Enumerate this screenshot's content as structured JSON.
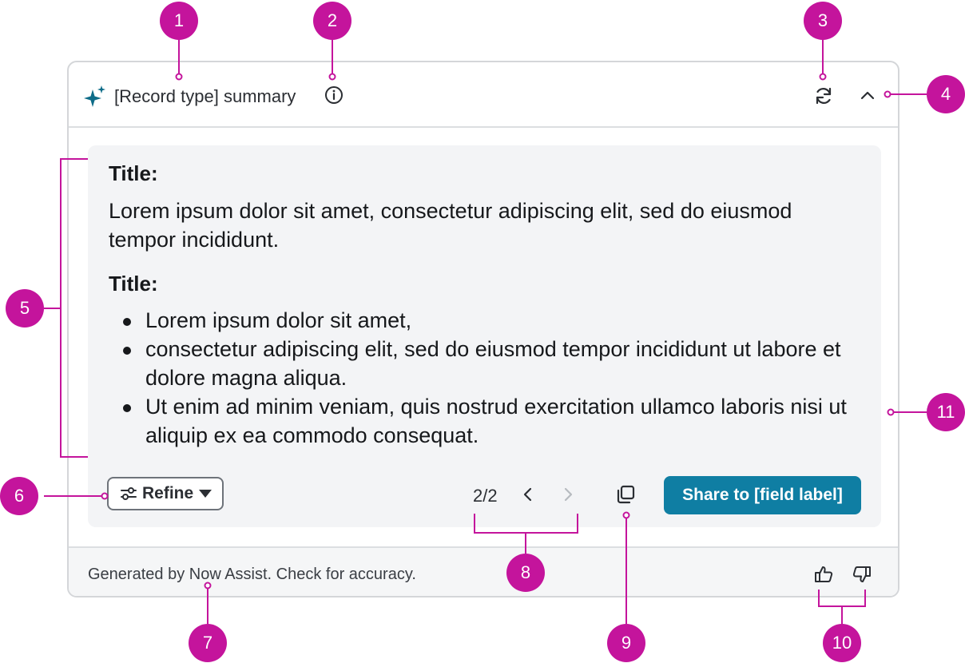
{
  "card": {
    "title": "[Record type] summary",
    "icons": {
      "sparkle": "sparkle-icon",
      "info": "info-icon",
      "refresh": "refresh-icon",
      "collapse": "chevron-up-icon"
    }
  },
  "content": {
    "section1": {
      "title": "Title:",
      "body": "Lorem ipsum dolor sit amet, consectetur adipiscing elit, sed do eiusmod tempor incididunt."
    },
    "section2": {
      "title": "Title:",
      "bullets": [
        "Lorem ipsum dolor sit amet,",
        "consectetur adipiscing elit, sed do eiusmod tempor incididunt ut labore et dolore magna aliqua.",
        "Ut enim ad minim veniam, quis nostrud exercitation ullamco laboris nisi ut aliquip ex ea commodo consequat."
      ]
    }
  },
  "actions": {
    "refine_label": "Refine",
    "pager": "2/2",
    "share_label": "Share to [field label]"
  },
  "footer": {
    "disclaimer": "Generated by Now Assist. Check for accuracy."
  },
  "annotations": [
    "1",
    "2",
    "3",
    "4",
    "5",
    "6",
    "7",
    "8",
    "9",
    "10",
    "11"
  ],
  "colors": {
    "annotation": "#c4149c",
    "primary_button": "#0f7ea3",
    "content_background": "#f3f4f6",
    "border": "#d4d6d9"
  }
}
